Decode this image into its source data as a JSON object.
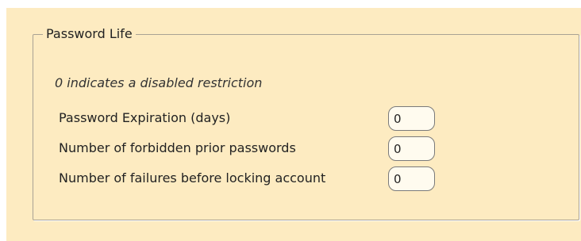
{
  "group": {
    "title": "Password Life",
    "hint": "0 indicates a disabled restriction"
  },
  "fields": [
    {
      "label": "Password Expiration (days)",
      "value": "0"
    },
    {
      "label": "Number of forbidden prior passwords",
      "value": "0"
    },
    {
      "label": "Number of failures before locking account",
      "value": "0"
    }
  ],
  "colors": {
    "panel_background": "#fdebc1",
    "field_background": "#fffbef",
    "border": "#a9a294"
  }
}
